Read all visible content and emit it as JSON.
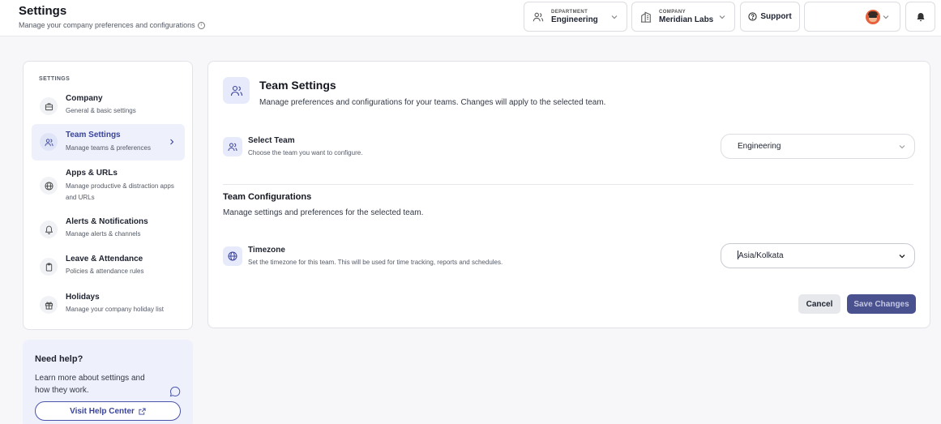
{
  "header": {
    "title": "Settings",
    "subtitle": "Manage your company preferences and configurations",
    "department": {
      "label": "DEPARTMENT",
      "value": "Engineering"
    },
    "company": {
      "label": "COMPANY",
      "value": "Meridian Labs"
    },
    "support_label": "Support"
  },
  "sidebar": {
    "heading": "SETTINGS",
    "items": [
      {
        "title": "Company",
        "desc": "General & basic settings",
        "icon": "briefcase-icon"
      },
      {
        "title": "Team Settings",
        "desc": "Manage teams & preferences",
        "icon": "users-icon",
        "active": true
      },
      {
        "title": "Apps & URLs",
        "desc": "Manage productive & distraction apps and URLs",
        "icon": "globe-icon"
      },
      {
        "title": "Alerts & Notifications",
        "desc": "Manage alerts & channels",
        "icon": "bell-icon"
      },
      {
        "title": "Leave & Attendance",
        "desc": "Policies & attendance rules",
        "icon": "clipboard-icon"
      },
      {
        "title": "Holidays",
        "desc": "Manage your company holiday list",
        "icon": "gift-icon"
      }
    ]
  },
  "help": {
    "title": "Need help?",
    "text": "Learn more about settings and how they work.",
    "button_label": "Visit Help Center"
  },
  "main": {
    "title": "Team Settings",
    "subtitle": "Manage preferences and configurations for your teams. Changes will apply to the selected team.",
    "select_team": {
      "title": "Select Team",
      "desc": "Choose the team you want to configure.",
      "value": "Engineering"
    },
    "config": {
      "title": "Team Configurations",
      "subtitle": "Manage settings and preferences for the selected team."
    },
    "timezone": {
      "title": "Timezone",
      "desc": "Set the timezone for this team. This will be used for time tracking, reports and schedules.",
      "value": "Asia/Kolkata"
    },
    "cancel_label": "Cancel",
    "save_label": "Save Changes"
  },
  "colors": {
    "accent": "#3a449a",
    "save_button": "#4a518f",
    "active_bg": "#eef0fb"
  }
}
